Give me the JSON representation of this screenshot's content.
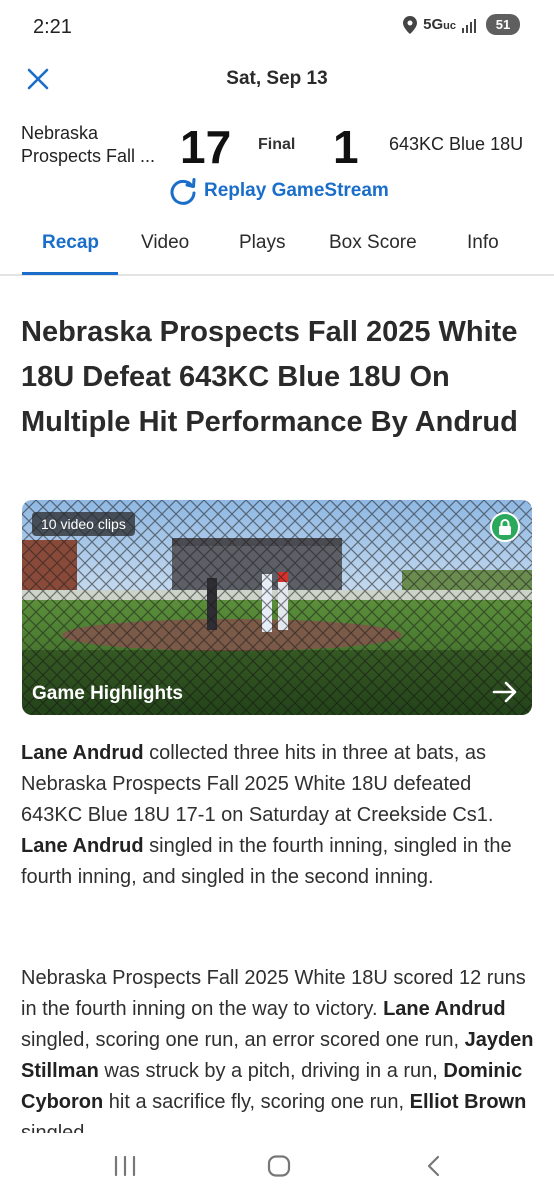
{
  "status": {
    "time": "2:21",
    "network": "5G",
    "network_suffix": "uc",
    "battery": "51"
  },
  "header": {
    "date": "Sat, Sep 13",
    "close_icon": "close-icon"
  },
  "scoreboard": {
    "home_team": "Nebraska Prospects Fall ...",
    "home_score": "17",
    "status": "Final",
    "away_score": "1",
    "away_team": "643KC Blue 18U",
    "replay_label": "Replay GameStream"
  },
  "tabs": [
    {
      "label": "Recap"
    },
    {
      "label": "Video"
    },
    {
      "label": "Plays"
    },
    {
      "label": "Box Score"
    },
    {
      "label": "Info"
    }
  ],
  "article": {
    "headline": "Nebraska Prospects Fall 2025 White 18U Defeat 643KC Blue 18U On Multiple Hit Performance By Andrud",
    "video": {
      "badge": "10 video clips",
      "label": "Game Highlights"
    },
    "p1": [
      {
        "t": "Lane Andrud",
        "b": true
      },
      {
        "t": " collected three hits in three at bats, as Nebraska Prospects Fall 2025 White 18U defeated 643KC Blue 18U 17-1 on Saturday at Creekside Cs1. ",
        "b": false
      },
      {
        "t": "Lane Andrud",
        "b": true
      },
      {
        "t": " singled in the fourth inning, singled in the fourth inning, and singled in the second inning.",
        "b": false
      }
    ],
    "p2": [
      {
        "t": "Nebraska Prospects Fall 2025 White 18U scored 12 runs in the fourth inning on the way to victory. ",
        "b": false
      },
      {
        "t": "Lane Andrud",
        "b": true
      },
      {
        "t": " singled, scoring one run, an error scored one run, ",
        "b": false
      },
      {
        "t": "Jayden Stillman",
        "b": true
      },
      {
        "t": " was struck by a pitch, driving in a run, ",
        "b": false
      },
      {
        "t": "Dominic Cyboron",
        "b": true
      },
      {
        "t": " hit a sacrifice fly, scoring one run, ",
        "b": false
      },
      {
        "t": "Elliot Brown",
        "b": true
      },
      {
        "t": " singled",
        "b": false
      }
    ]
  },
  "colors": {
    "accent": "#1a6ec9",
    "lock": "#2aa85c"
  }
}
